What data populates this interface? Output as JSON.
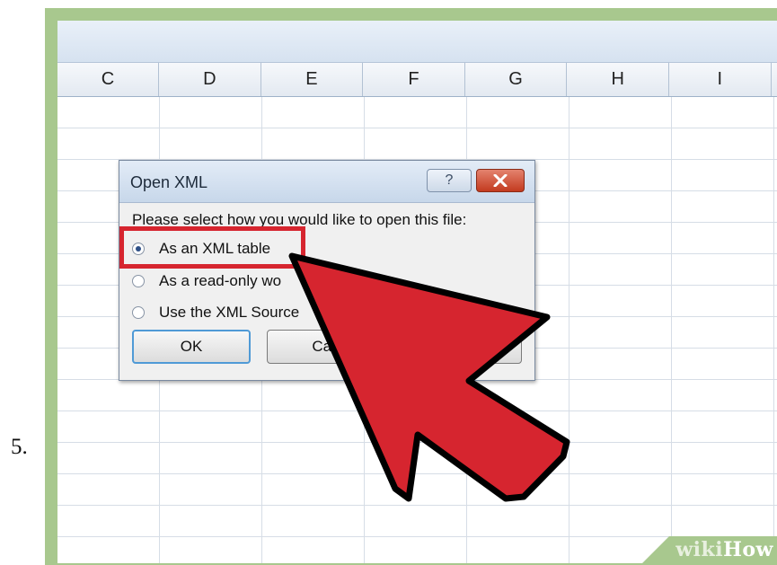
{
  "step": {
    "number": "5."
  },
  "spreadsheet": {
    "columns": [
      "C",
      "D",
      "E",
      "F",
      "G",
      "H",
      "I"
    ]
  },
  "dialog": {
    "title": "Open XML",
    "help_glyph": "?",
    "close_glyph": "✕",
    "prompt": "Please select how you would like to open this file:",
    "options": [
      {
        "label": "As an XML table",
        "selected": true
      },
      {
        "label": "As a read-only wo",
        "selected": false
      },
      {
        "label": "Use the XML Source",
        "selected": false
      }
    ],
    "ok_label": "OK",
    "cancel_label": "Can",
    "help_button_label": ""
  },
  "annotation": {
    "highlight_color": "#d6252f",
    "arrow_color": "#d6252f"
  },
  "watermark": {
    "part1": "wiki",
    "part2": "How"
  }
}
